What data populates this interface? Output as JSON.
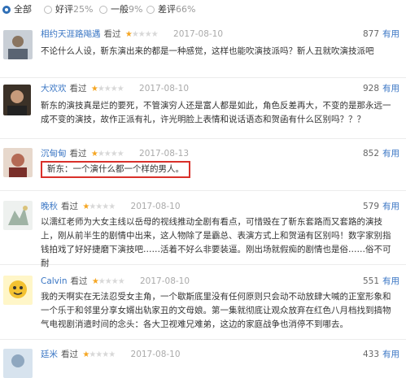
{
  "filters": [
    {
      "label": "全部",
      "pct": "",
      "selected": true
    },
    {
      "label": "好评",
      "pct": "25%",
      "selected": false
    },
    {
      "label": "一般",
      "pct": "9%",
      "selected": false
    },
    {
      "label": "差评",
      "pct": "66%",
      "selected": false
    }
  ],
  "reviews": [
    {
      "user": "相约天涯路飚遇",
      "action": "看过",
      "rating": 1,
      "date": "2017-08-10",
      "useful_count": "877",
      "useful_label": "有用",
      "text": "不论什么人设，靳东演出来的都是一种感觉，这样也能吹演技派吗？靳人丑就吹演技派吧"
    },
    {
      "user": "大欢欢",
      "action": "看过",
      "rating": 1,
      "date": "2017-08-10",
      "useful_count": "928",
      "useful_label": "有用",
      "text": "靳东的演技真是烂的要死，不管演穷人还是富人都是如此，角色反差再大，不变的是那永远一成不变的演技，故作正派有礼，许光明脸上表情和说话语态和贺函有什么区别吗？？？"
    },
    {
      "user": "沉甸甸",
      "action": "看过",
      "rating": 1,
      "date": "2017-08-13",
      "useful_count": "852",
      "useful_label": "有用",
      "text": "靳东：一个演什么都一个样的男人。"
    },
    {
      "user": "晚秋",
      "action": "看过",
      "rating": 1,
      "date": "2017-08-10",
      "useful_count": "579",
      "useful_label": "有用",
      "text": "以濡红老师为大女主线以岳母的视线推动全剧有看点，可惜毁在了靳东套路而又套路的演技上，刚从前半生的剧情中出来，这人物除了是霸总、表演方式上和贺涵有区别吗！数字家别指钱拍戏了好好捷磨下演技吧……活着不好么非要装逼。刚出场就假痴的剧情也是俗……俗不可耐"
    },
    {
      "user": "Calvin",
      "action": "看过",
      "rating": 1,
      "date": "2017-08-10",
      "useful_count": "551",
      "useful_label": "有用",
      "text": "我的天啊实在无法忍受女主角，一个歇斯底里没有任何原则只会动不动放肆大喊的正室形象和一个乐于和邻里分享女婿出轨家丑的文母娘。第一集就彻底让观众放弃在红色八月档找到搞物气电视剧消遣时间的念头：各大卫视难兄难弟，这边的家庭战争也消停不到哪去。"
    },
    {
      "user": "廷米",
      "action": "看过",
      "rating": 1,
      "date": "2017-08-10",
      "useful_count": "433",
      "useful_label": "有用",
      "text": ""
    }
  ],
  "colors": {
    "accent": "#3a76c4",
    "star": "#f5a623",
    "highlight_border": "#d9302a"
  }
}
